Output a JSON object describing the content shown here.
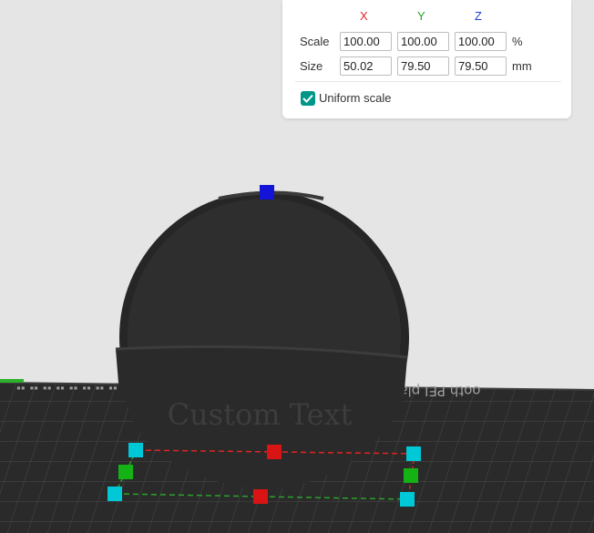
{
  "scale_panel": {
    "axes": {
      "x": "X",
      "y": "Y",
      "z": "Z"
    },
    "scale": {
      "label": "Scale",
      "x": "100.00",
      "y": "100.00",
      "z": "100.00",
      "unit": "%"
    },
    "size": {
      "label": "Size",
      "x": "50.02",
      "y": "79.50",
      "z": "79.50",
      "unit": "mm"
    },
    "uniform_scale": {
      "label": "Uniform scale",
      "checked": true
    }
  },
  "viewport": {
    "model_text": "Custom Text",
    "bed_text": "ooth PEI plat"
  },
  "colors": {
    "accent": "#009688",
    "axis_x": "#e02424",
    "axis_y": "#2aa22a",
    "axis_z": "#1f3fd6",
    "handle_corner": "#00c8d7",
    "bed": "#2c2c2c",
    "model": "#2b2b2b"
  }
}
